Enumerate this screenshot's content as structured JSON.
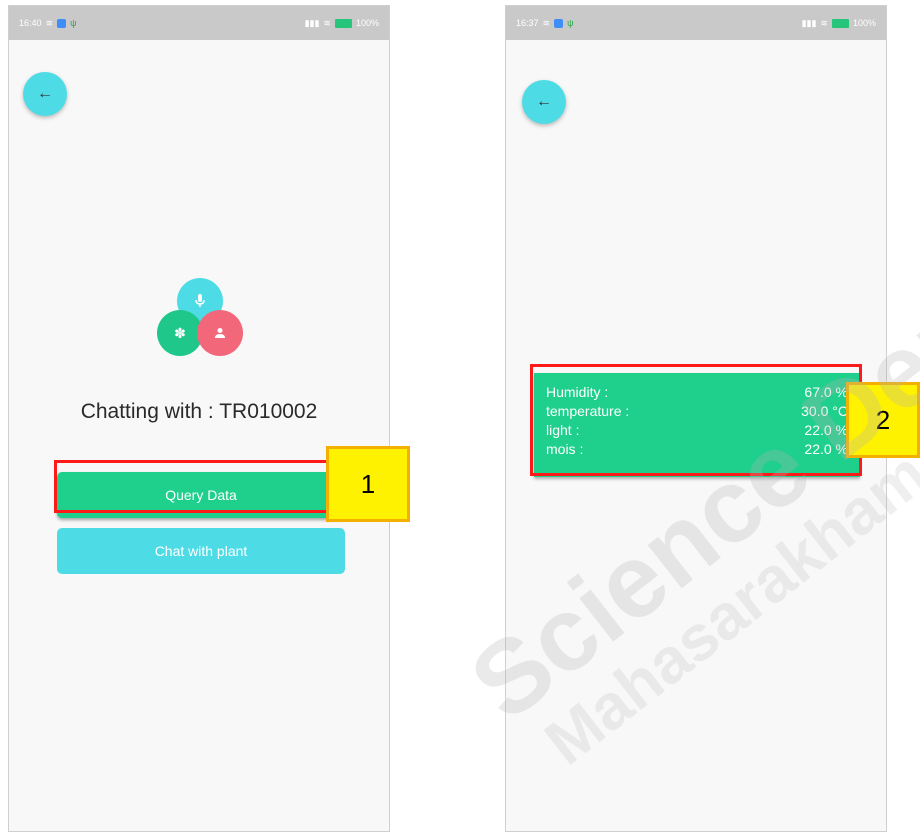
{
  "left_screen": {
    "status": {
      "time": "16:40",
      "battery": "100%"
    },
    "chat_title": "Chatting with : TR010002",
    "query_button": "Query Data",
    "chat_button": "Chat with plant"
  },
  "right_screen": {
    "status": {
      "time": "16:37",
      "battery": "100%"
    },
    "sensor_data": [
      {
        "label": "Humidity :",
        "value": "67.0 %"
      },
      {
        "label": "temperature :",
        "value": "30.0 °C"
      },
      {
        "label": "light :",
        "value": "22.0 %"
      },
      {
        "label": "mois :",
        "value": "22.0 %"
      }
    ]
  },
  "annotations": {
    "callout_1": "1",
    "callout_2": "2"
  },
  "watermark": {
    "line1": "Science Department",
    "line2": "Mahasarakham University"
  },
  "colors": {
    "accent_green": "#1fcf8c",
    "accent_cyan": "#4ddce6",
    "accent_pink": "#f2687a",
    "highlight_red": "#ff1a1a",
    "callout_yellow": "#fff200"
  },
  "icons": {
    "back": "arrow-left-icon",
    "mic": "microphone-icon",
    "settings": "gear-icon",
    "user": "person-icon"
  }
}
